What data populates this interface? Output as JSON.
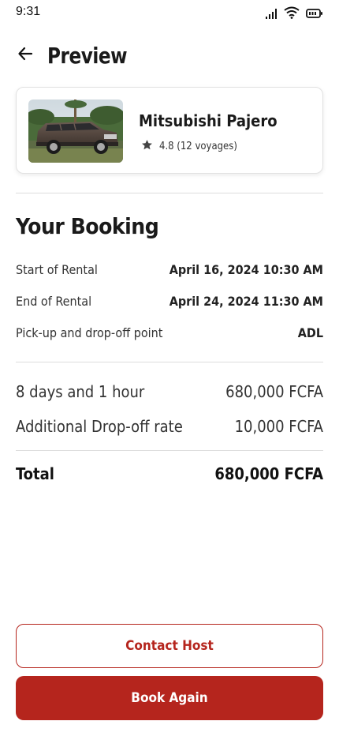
{
  "status_bar": {
    "time": "9:31"
  },
  "header": {
    "title": "Preview",
    "back_icon": "arrow-left-icon"
  },
  "car": {
    "name": "Mitsubishi Pajero",
    "rating": "4.8 (12 voyages)",
    "rating_icon": "star-icon"
  },
  "booking": {
    "title": "Your Booking",
    "rows": [
      {
        "label": "Start of Rental",
        "value": "April 16, 2024 10:30 AM"
      },
      {
        "label": "End of Rental",
        "value": "April 24, 2024 11:30 AM"
      },
      {
        "label": "Pick-up and drop-off point",
        "value": "ADL"
      }
    ]
  },
  "costs": [
    {
      "label": "8 days and 1 hour",
      "value": "680,000 FCFA"
    },
    {
      "label": "Additional Drop-off rate",
      "value": "10,000 FCFA"
    }
  ],
  "total": {
    "label": "Total",
    "value": "680,000 FCFA"
  },
  "actions": {
    "contact_label": "Contact Host",
    "book_label": "Book Again"
  },
  "colors": {
    "accent": "#b5251d"
  }
}
